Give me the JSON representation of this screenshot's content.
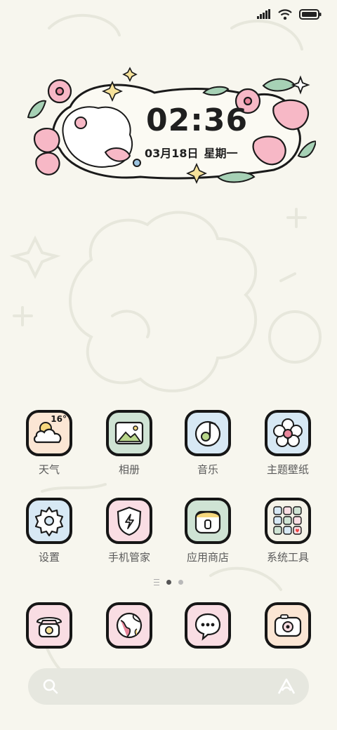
{
  "status_bar": {
    "signal_icon": "signal-icon",
    "wifi_icon": "wifi-icon",
    "battery_icon": "battery-icon"
  },
  "clock_widget": {
    "time": "02:36",
    "date": "03月18日",
    "weekday": "星期一"
  },
  "apps": [
    {
      "label": "天气",
      "icon": "weather-icon",
      "badge": "16°",
      "bg": "#fbe6d4"
    },
    {
      "label": "相册",
      "icon": "gallery-icon",
      "bg": "#cfe3d4"
    },
    {
      "label": "音乐",
      "icon": "music-icon",
      "bg": "#d7e8f4"
    },
    {
      "label": "主题壁纸",
      "icon": "flower-theme-icon",
      "bg": "#d7e8f4"
    },
    {
      "label": "设置",
      "icon": "gear-icon",
      "bg": "#d7e8f4"
    },
    {
      "label": "手机管家",
      "icon": "shield-icon",
      "bg": "#f9dde3"
    },
    {
      "label": "应用商店",
      "icon": "store-icon",
      "bg": "#cfe3d4"
    },
    {
      "label": "系统工具",
      "icon": "tools-folder-icon",
      "bg": "#f4f2e8"
    }
  ],
  "page_indicator": {
    "pages": 2,
    "active": 1
  },
  "dock": [
    {
      "name": "phone",
      "icon": "phone-icon",
      "bg": "#f9dde3"
    },
    {
      "name": "browser",
      "icon": "browser-icon",
      "bg": "#f9dde3"
    },
    {
      "name": "messages",
      "icon": "message-icon",
      "bg": "#f9dde3"
    },
    {
      "name": "camera",
      "icon": "camera-icon",
      "bg": "#fbe6d4"
    }
  ],
  "search_bar": {
    "search_icon": "search-icon",
    "assistant_icon": "assistant-icon"
  }
}
